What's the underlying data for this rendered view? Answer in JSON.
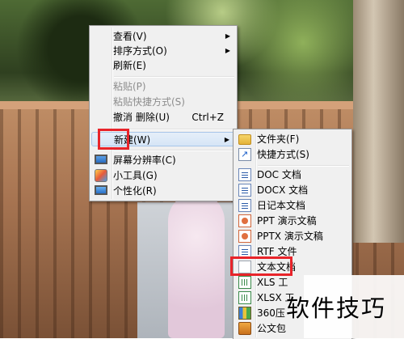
{
  "desktop_menu": {
    "items": [
      {
        "label": "查看(V)",
        "submenu": true
      },
      {
        "label": "排序方式(O)",
        "submenu": true
      },
      {
        "label": "刷新(E)"
      },
      {
        "label": "粘贴(P)",
        "disabled": true
      },
      {
        "label": "粘贴快捷方式(S)",
        "disabled": true
      },
      {
        "label": "撤消 删除(U)",
        "shortcut": "Ctrl+Z"
      },
      {
        "label": "新建(W)",
        "submenu": true,
        "highlighted": true
      },
      {
        "label": "屏幕分辨率(C)",
        "icon": "display-icon"
      },
      {
        "label": "小工具(G)",
        "icon": "gadget-icon"
      },
      {
        "label": "个性化(R)",
        "icon": "personalize-icon"
      }
    ]
  },
  "new_submenu": {
    "items": [
      {
        "label": "文件夹(F)",
        "icon": "folder-icon"
      },
      {
        "label": "快捷方式(S)",
        "icon": "shortcut-icon"
      },
      {
        "label": "DOC 文档",
        "icon": "word-doc-icon"
      },
      {
        "label": "DOCX 文档",
        "icon": "word-docx-icon"
      },
      {
        "label": "日记本文档",
        "icon": "journal-icon"
      },
      {
        "label": "PPT 演示文稿",
        "icon": "ppt-icon"
      },
      {
        "label": "PPTX 演示文稿",
        "icon": "pptx-icon"
      },
      {
        "label": "RTF 文件",
        "icon": "rtf-icon"
      },
      {
        "label": "文本文档",
        "icon": "text-doc-icon",
        "highlighted": true
      },
      {
        "label": "XLS 工",
        "icon": "xls-icon"
      },
      {
        "label": "XLSX 工",
        "icon": "xlsx-icon"
      },
      {
        "label": "360压",
        "icon": "zip-icon"
      },
      {
        "label": "公文包",
        "icon": "briefcase-icon"
      }
    ]
  },
  "watermark": {
    "text": "软件技巧"
  },
  "colors": {
    "highlight_border": "#e8242a",
    "menu_bg": "#f0f0f0",
    "hover_bg": "#d6e5f6"
  }
}
